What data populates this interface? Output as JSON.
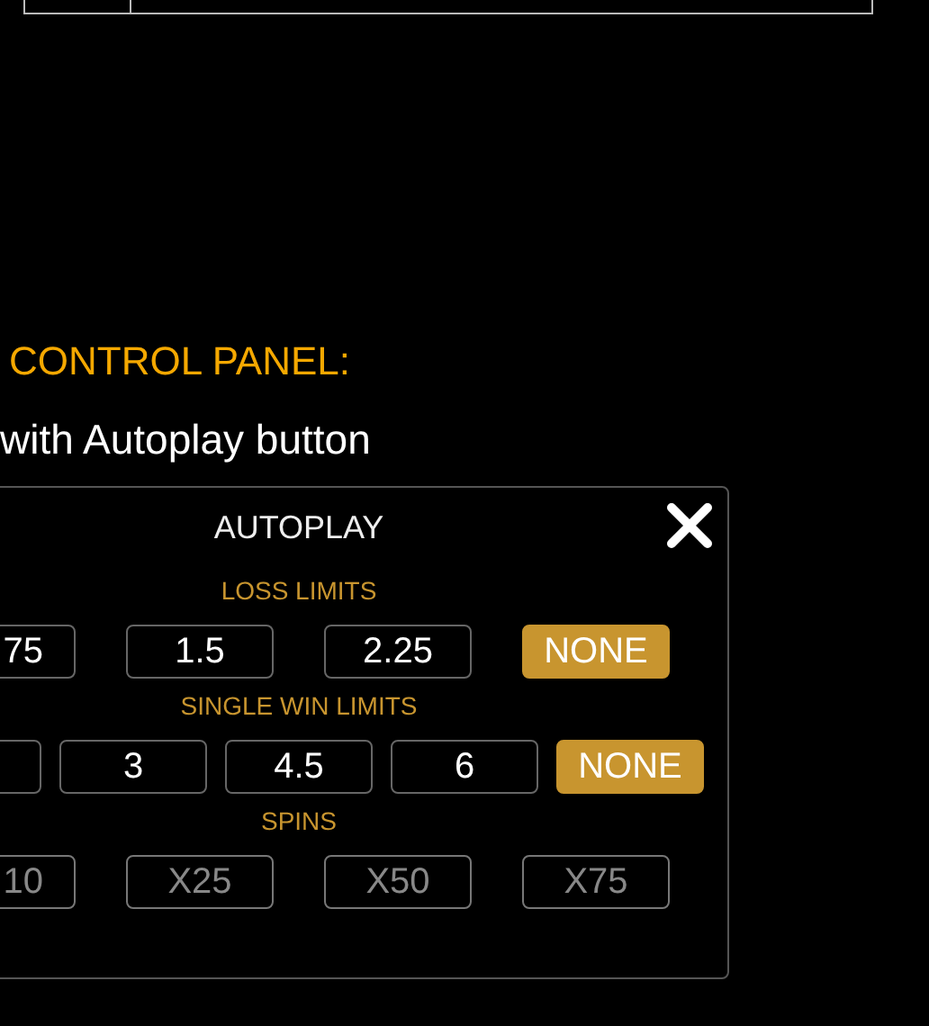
{
  "heading": "CONTROL PANEL:",
  "subheading": "with Autoplay button",
  "dialog": {
    "title": "AUTOPLAY",
    "sections": [
      {
        "label": "LOSS LIMITS",
        "options": [
          {
            "label": "75",
            "selected": false,
            "disabled": false
          },
          {
            "label": "1.5",
            "selected": false,
            "disabled": false
          },
          {
            "label": "2.25",
            "selected": false,
            "disabled": false
          },
          {
            "label": "NONE",
            "selected": true,
            "disabled": false
          }
        ]
      },
      {
        "label": "SINGLE WIN LIMITS",
        "options": [
          {
            "selected": false,
            "disabled": false
          },
          {
            "label": "3",
            "selected": false,
            "disabled": false
          },
          {
            "label": "4.5",
            "selected": false,
            "disabled": false
          },
          {
            "label": "6",
            "selected": false,
            "disabled": false
          },
          {
            "label": "NONE",
            "selected": true,
            "disabled": false
          }
        ]
      },
      {
        "label": "SPINS",
        "options": [
          {
            "label": "10",
            "selected": false,
            "disabled": true
          },
          {
            "label": "X25",
            "selected": false,
            "disabled": true
          },
          {
            "label": "X50",
            "selected": false,
            "disabled": true
          },
          {
            "label": "X75",
            "selected": false,
            "disabled": true
          }
        ]
      }
    ]
  }
}
